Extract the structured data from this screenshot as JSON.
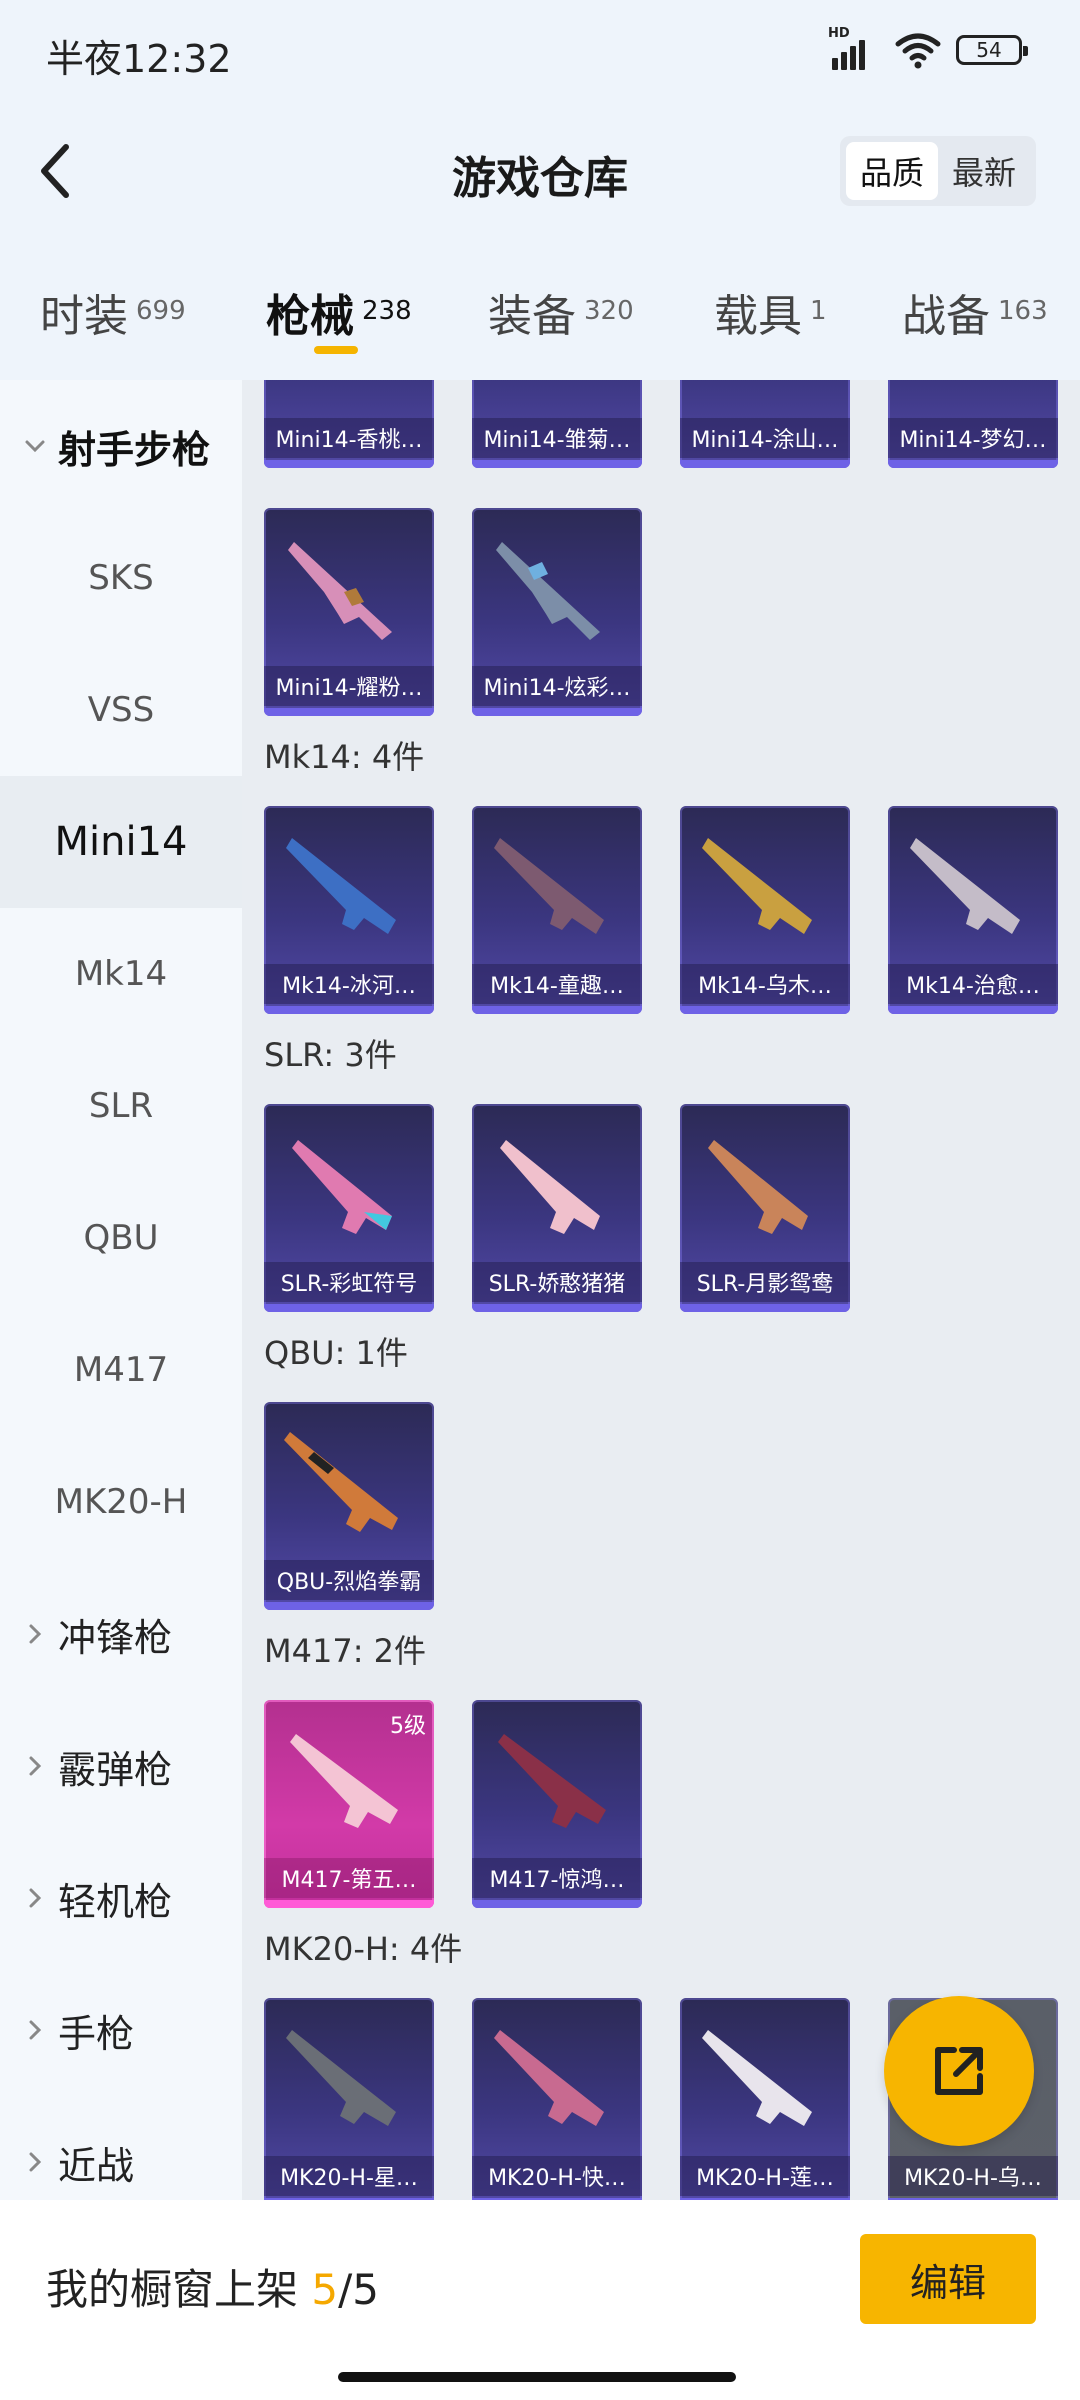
{
  "status": {
    "time": "半夜12:32",
    "network": "HD",
    "battery": "54"
  },
  "header": {
    "title": "游戏仓库",
    "sort_options": [
      "品质",
      "最新"
    ],
    "sort_active": "品质"
  },
  "tabs": [
    {
      "label": "时装",
      "count": "699"
    },
    {
      "label": "枪械",
      "count": "238"
    },
    {
      "label": "装备",
      "count": "320"
    },
    {
      "label": "载具",
      "count": "1"
    },
    {
      "label": "战备",
      "count": "163"
    }
  ],
  "active_tab": "枪械",
  "sidebar": {
    "group_open": "射手步枪",
    "sub_items": [
      "SKS",
      "VSS",
      "Mini14",
      "Mk14",
      "SLR",
      "QBU",
      "M417",
      "MK20-H"
    ],
    "active_sub": "Mini14",
    "groups_closed": [
      "冲锋枪",
      "霰弹枪",
      "轻机枪",
      "手枪",
      "近战"
    ]
  },
  "content": {
    "mini14_partial": [
      "Mini14-香桃…",
      "Mini14-雏菊…",
      "Mini14-涂山…",
      "Mini14-梦幻…"
    ],
    "mini14_more": [
      "Mini14-耀粉…",
      "Mini14-炫彩…"
    ],
    "sections": [
      {
        "title": "Mk14: 4件",
        "items": [
          "Mk14-冰河…",
          "Mk14-童趣…",
          "Mk14-乌木…",
          "Mk14-治愈…"
        ]
      },
      {
        "title": "SLR: 3件",
        "items": [
          "SLR-彩虹符号",
          "SLR-娇憨猪猪",
          "SLR-月影鸳鸯"
        ]
      },
      {
        "title": "QBU: 1件",
        "items": [
          "QBU-烈焰拳霸"
        ]
      },
      {
        "title": "M417: 2件",
        "items": [
          "M417-第五…",
          "M417-惊鸿…"
        ],
        "level_badge": "5级"
      },
      {
        "title": "MK20-H: 4件",
        "items": [
          "MK20-H-星…",
          "MK20-H-快…",
          "MK20-H-莲…",
          "MK20-H-乌…"
        ]
      }
    ]
  },
  "bottom": {
    "showcase_label": "我的橱窗上架",
    "current": "5",
    "separator": "/",
    "total": "5",
    "edit_label": "编辑"
  }
}
